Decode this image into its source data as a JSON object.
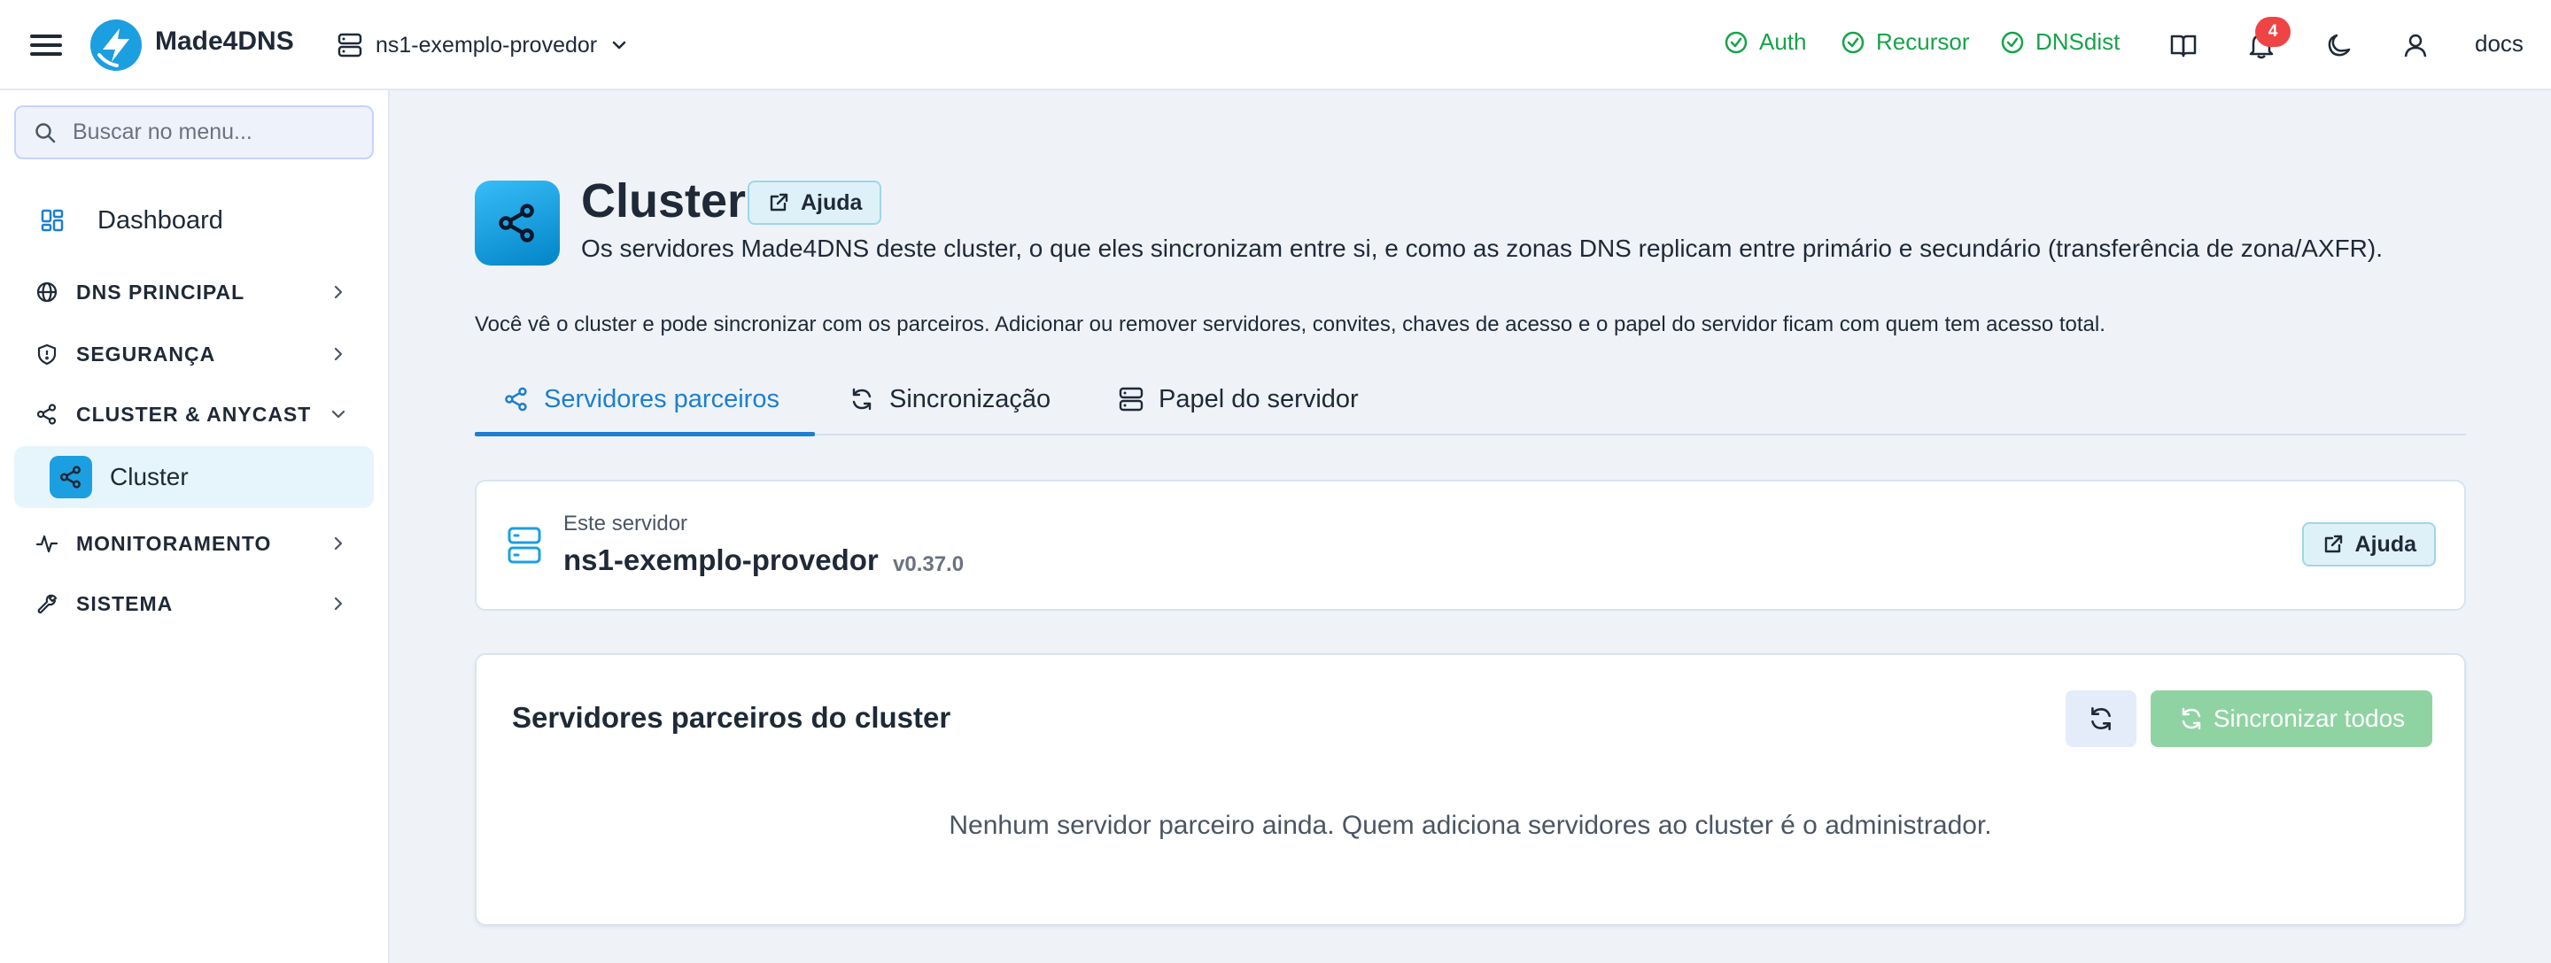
{
  "header": {
    "app_name": "Made4DNS",
    "server_selector": "ns1-exemplo-provedor",
    "status": [
      {
        "label": "Auth"
      },
      {
        "label": "Recursor"
      },
      {
        "label": "DNSdist"
      }
    ],
    "notification_count": "4",
    "docs_label": "docs"
  },
  "sidebar": {
    "search_placeholder": "Buscar no menu...",
    "dashboard_label": "Dashboard",
    "sections": [
      {
        "label": "DNS PRINCIPAL"
      },
      {
        "label": "SEGURANÇA"
      },
      {
        "label": "CLUSTER & ANYCAST"
      },
      {
        "label": "MONITORAMENTO"
      },
      {
        "label": "SISTEMA"
      }
    ],
    "active_item": "Cluster"
  },
  "page": {
    "title": "Cluster",
    "help_label": "Ajuda",
    "subtitle": "Os servidores Made4DNS deste cluster, o que eles sincronizam entre si, e como as zonas DNS replicam entre primário e secundário (transferência de zona/AXFR).",
    "note": "Você vê o cluster e pode sincronizar com os parceiros. Adicionar ou remover servidores, convites, chaves de acesso e o papel do servidor ficam com quem tem acesso total.",
    "tabs": [
      {
        "label": "Servidores parceiros"
      },
      {
        "label": "Sincronização"
      },
      {
        "label": "Papel do servidor"
      }
    ]
  },
  "this_server": {
    "caption": "Este servidor",
    "name": "ns1-exemplo-provedor",
    "version": "v0.37.0",
    "help_label": "Ajuda"
  },
  "peers": {
    "heading": "Servidores parceiros do cluster",
    "sync_all_label": "Sincronizar todos",
    "empty_message": "Nenhum servidor parceiro ainda. Quem adiciona servidores ao cluster é o administrador."
  },
  "colors": {
    "accent": "#1d7fd0",
    "status_ok": "#16a34a",
    "badge": "#ef4444",
    "sync_disabled": "#8fd3a2"
  }
}
